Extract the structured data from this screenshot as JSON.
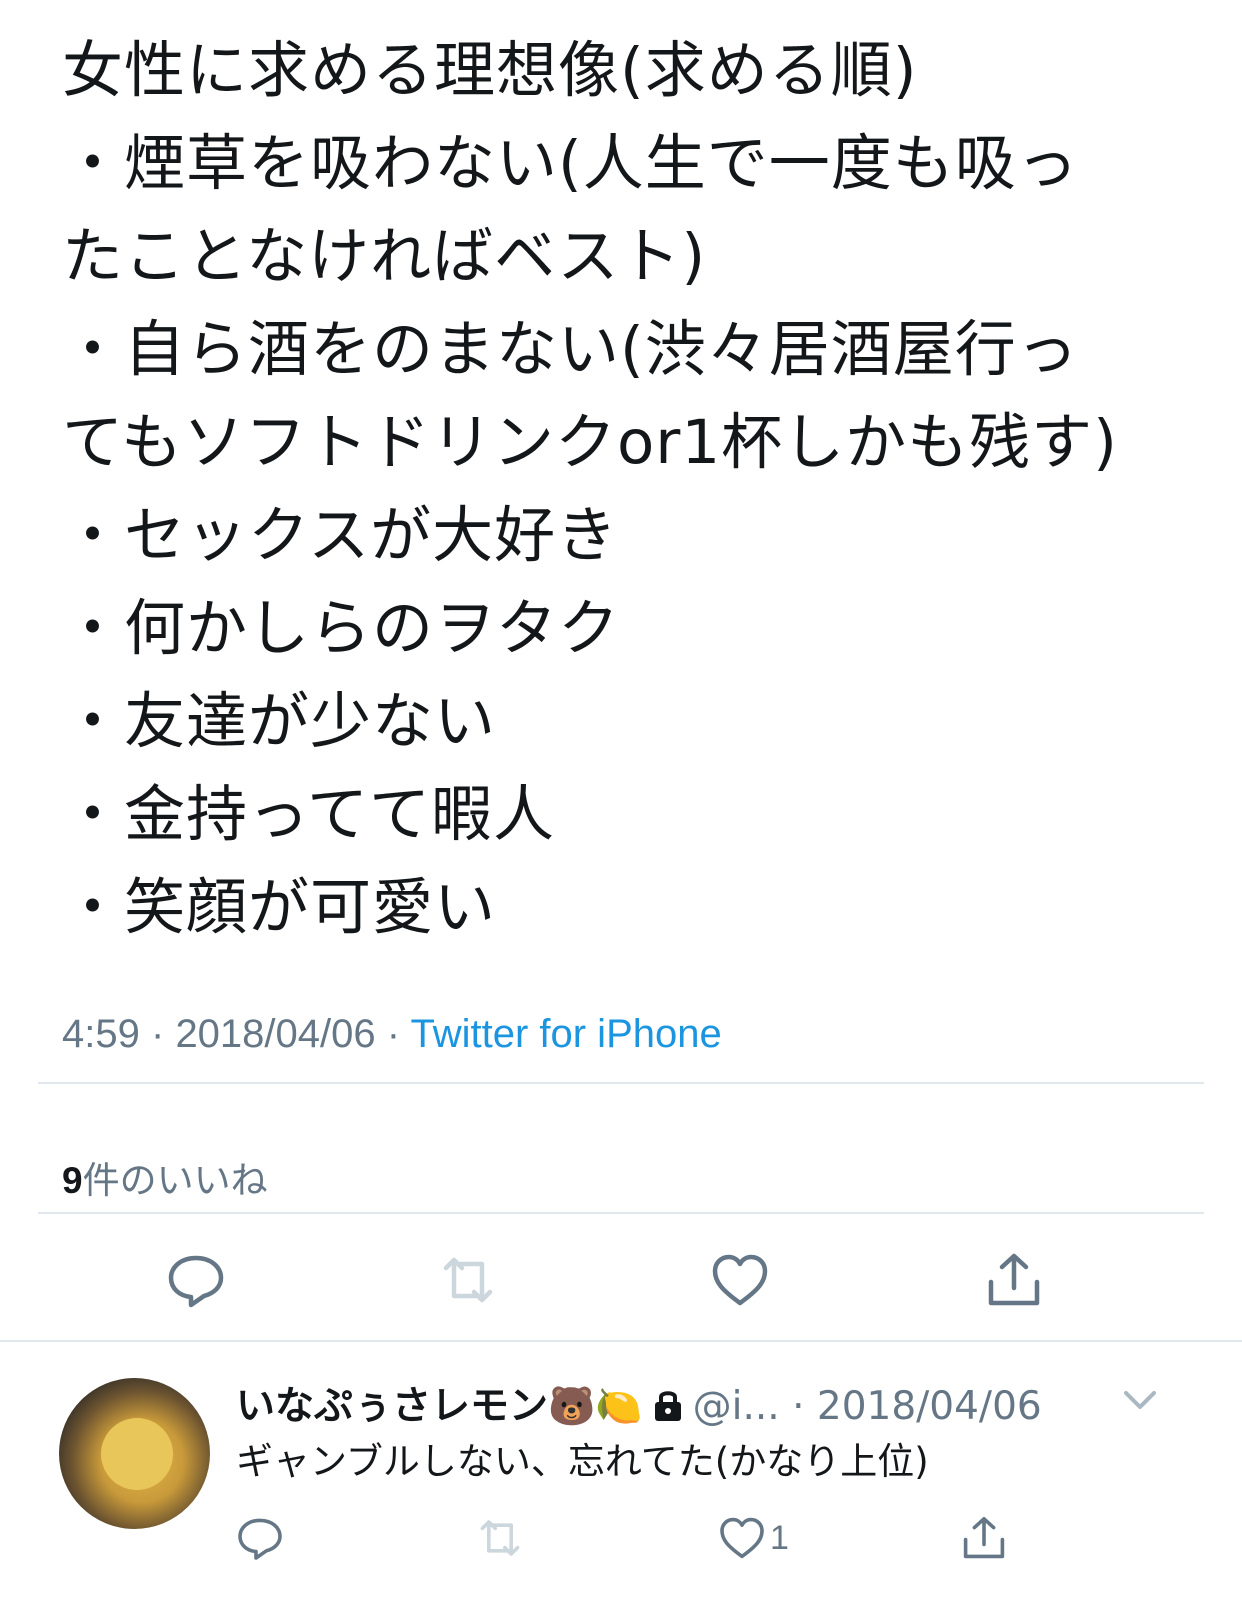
{
  "tweet": {
    "lines": [
      "女性に求める理想像(求める順)",
      "・煙草を吸わない(人生で一度も吸っ",
      "たことなければベスト)",
      "・自ら酒をのまない(渋々居酒屋行っ",
      "てもソフトドリンクor1杯しかも残す)",
      "・セックスが大好き",
      "・何かしらのヲタク",
      "・友達が少ない",
      "・金持ってて暇人",
      "・笑顔が可愛い"
    ],
    "time": "4:59",
    "date": "2018/04/06",
    "source": "Twitter for iPhone",
    "separator": "·",
    "likes_count": "9",
    "likes_label": "件のいいね"
  },
  "actions": {
    "reply_icon": "reply-icon",
    "retweet_icon": "retweet-icon",
    "like_icon": "heart-icon",
    "share_icon": "share-icon"
  },
  "reply": {
    "name": "いなぷぅさレモン",
    "emoji": "🐻🍋",
    "handle": "@i...",
    "separator": "·",
    "date": "2018/04/06",
    "text": "ギャンブルしない、忘れてた(かなり上位)",
    "like_count": "1"
  },
  "colors": {
    "text": "#14171a",
    "secondary": "#657786",
    "link": "#1b95e0",
    "divider": "#e1e8ed",
    "icon": "#657786",
    "icon_disabled": "#ccd6dd"
  }
}
